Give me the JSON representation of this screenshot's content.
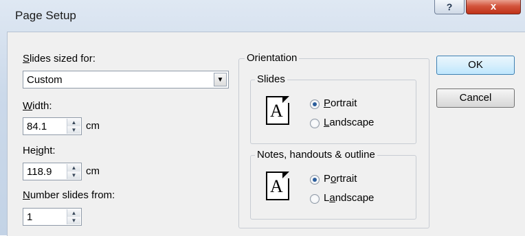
{
  "window": {
    "title": "Page Setup",
    "help_label": "?",
    "close_label": "x"
  },
  "slides_sized_for": {
    "label_mnemonic": "S",
    "label_rest": "lides sized for:",
    "value": "Custom"
  },
  "width": {
    "label_mnemonic": "W",
    "label_rest": "idth:",
    "value": "84.1",
    "unit": "cm"
  },
  "height": {
    "label_pre": "He",
    "label_mnemonic": "i",
    "label_rest": "ght:",
    "value": "118.9",
    "unit": "cm"
  },
  "number_slides_from": {
    "label_mnemonic": "N",
    "label_rest": "umber slides from:",
    "value": "1"
  },
  "orientation": {
    "title": "Orientation",
    "slides": {
      "title": "Slides",
      "icon_letter": "A",
      "portrait_mnemonic": "P",
      "portrait_rest": "ortrait",
      "landscape_mnemonic": "L",
      "landscape_rest": "andscape",
      "selected": "portrait"
    },
    "notes": {
      "title": "Notes, handouts & outline",
      "icon_letter": "A",
      "portrait_pre": "P",
      "portrait_mnemonic": "o",
      "portrait_rest": "rtrait",
      "landscape_pre": "L",
      "landscape_mnemonic": "a",
      "landscape_rest": "ndscape",
      "selected": "portrait"
    }
  },
  "buttons": {
    "ok": "OK",
    "cancel": "Cancel"
  },
  "colors": {
    "close_button": "#c8452b",
    "default_button_border": "#3c7fb1"
  }
}
